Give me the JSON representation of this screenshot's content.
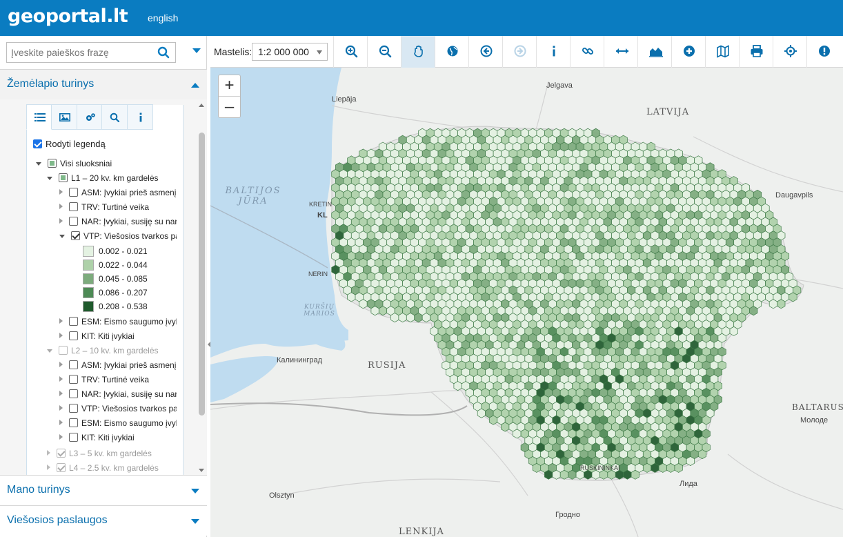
{
  "header": {
    "logo_text": "geoportal.lt",
    "language_link": "english"
  },
  "search": {
    "placeholder": "Įveskite paieškos frazę"
  },
  "sections": {
    "map_content": "Žemėlapio turinys",
    "my_content": "Mano turinys",
    "public_services": "Viešosios paslaugos"
  },
  "panel_tabs": [
    "list-icon",
    "image-icon",
    "gears-icon",
    "search-icon",
    "info-icon"
  ],
  "legend_toggle": {
    "label": "Rodyti legendą",
    "checked": true
  },
  "tree": {
    "all_layers": "Visi sluoksniai",
    "l1": {
      "label": "L1 – 20 kv. km gardelės",
      "items": [
        "ASM: Įvykiai prieš asmenį",
        "TRV: Turtinė veika",
        "NAR: Įvykiai, susiję su narkotikais",
        "VTP: Viešosios tvarkos pažeidimai",
        "ESM: Eismo saugumo įvykiai",
        "KIT: Kiti įvykiai"
      ],
      "legend": [
        {
          "label": "0.002 - 0.021",
          "color": "#e4f2e2"
        },
        {
          "label": "0.022 - 0.044",
          "color": "#aed1a9"
        },
        {
          "label": "0.045 - 0.085",
          "color": "#7dab7d"
        },
        {
          "label": "0.086 - 0.207",
          "color": "#4d8a55"
        },
        {
          "label": "0.208 - 0.538",
          "color": "#1f5a2c"
        }
      ]
    },
    "l2": {
      "label": "L2 – 10 kv. km gardelės",
      "items": [
        "ASM: Įvykiai prieš asmenį",
        "TRV: Turtinė veika",
        "NAR: Įvykiai, susiję su narkotikais",
        "VTP: Viešosios tvarkos pažeidimai",
        "ESM: Eismo saugumo įvykiai",
        "KIT: Kiti įvykiai"
      ]
    },
    "l3": {
      "label": "L3 – 5 kv. km gardelės"
    },
    "l4": {
      "label": "L4 – 2.5 kv. km gardelės"
    }
  },
  "toolbar": {
    "scale_label": "Mastelis:",
    "scale_value": "1:2 000 000",
    "tools": [
      "zoom-in-icon",
      "zoom-out-icon",
      "pan-hand-icon",
      "globe-icon",
      "back-icon",
      "forward-icon",
      "info-icon",
      "link-icon",
      "measure-icon",
      "profile-icon",
      "add-icon",
      "map-icon",
      "print-icon",
      "locate-icon",
      "alert-icon"
    ]
  },
  "map": {
    "zoom_in": "+",
    "zoom_out": "–",
    "labels": {
      "jelgava": "Jelgava",
      "liepaja": "Liepāja",
      "latvija": "LATVIJA",
      "baltijos": "BALTIJOS",
      "jura": "JŪRA",
      "daugavpils": "Daugavpils",
      "kaliningrad": "Калининград",
      "rusija": "RUSIJA",
      "kursiu": "KURŠIŲ",
      "marios": "MARIOS",
      "baltarusija": "BALTARUS",
      "molodechno": "Молоде",
      "lida": "Лида",
      "grodno": "Гродно",
      "olsztyn": "Olsztyn",
      "lenkija": "LENKIJA",
      "kretinga": "KRETIN",
      "klaipeda": "KL",
      "neringa": "NERIN",
      "druskininkai": "RUSKININKAI"
    }
  },
  "colors": {
    "brand": "#0a7cc1",
    "water": "#bfdcf0",
    "land": "#eef0ee"
  }
}
